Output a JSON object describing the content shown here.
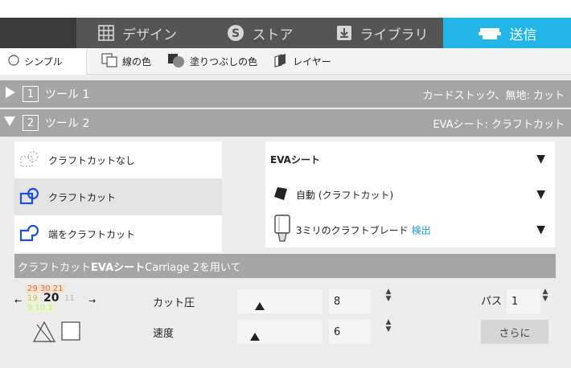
{
  "tabs": [
    {
      "label": "デザイン",
      "icon": "grid-icon"
    },
    {
      "label": "ストア",
      "icon": "store-s-icon"
    },
    {
      "label": "ライブラリ",
      "icon": "download-box-icon"
    },
    {
      "label": "送信",
      "icon": "send-machine-icon",
      "active": true
    }
  ],
  "subtabs": {
    "simple": "シンプル",
    "line_color": "線の色",
    "fill_color": "塗りつぶしの色",
    "layer": "レイヤー"
  },
  "tools": [
    {
      "number": "1",
      "label": "ツール 1",
      "material": "カードストック、無地: カット",
      "expanded": false
    },
    {
      "number": "2",
      "label": "ツール 2",
      "material": "EVAシート: クラフトカット",
      "expanded": true
    }
  ],
  "cut_options": [
    {
      "label": "クラフトカットなし",
      "icon": "no-craft-cut-icon",
      "selected": false
    },
    {
      "label": "クラフトカット",
      "icon": "craft-cut-icon",
      "selected": true
    },
    {
      "label": "端をクラフトカット",
      "icon": "edge-craft-cut-icon",
      "selected": false
    }
  ],
  "material_dropdown": {
    "value": "EVAシート"
  },
  "action_dropdown": {
    "value": "自動 (クラフトカット)"
  },
  "blade_dropdown": {
    "value": "3ミリのクラフトブレード",
    "detect": "検出"
  },
  "info_bar": {
    "prefix": "クラフトカット ",
    "material": "EVAシート",
    "suffix": " Carriage 2を用いて"
  },
  "matrix": {
    "top": "29  30  21",
    "middle_left": "19",
    "middle_center": "20",
    "middle_right": "11",
    "bottom": "9   10   1"
  },
  "settings": {
    "force_label": "カット圧",
    "force_value": "8",
    "speed_label": "速度",
    "speed_value": "6",
    "passes_label": "パス",
    "passes_value": "1",
    "more_button": "さらに"
  },
  "colors": {
    "accent": "#23b5e8",
    "blade_blue": "#1d4fd8",
    "detect_link": "#1a9ad6"
  }
}
